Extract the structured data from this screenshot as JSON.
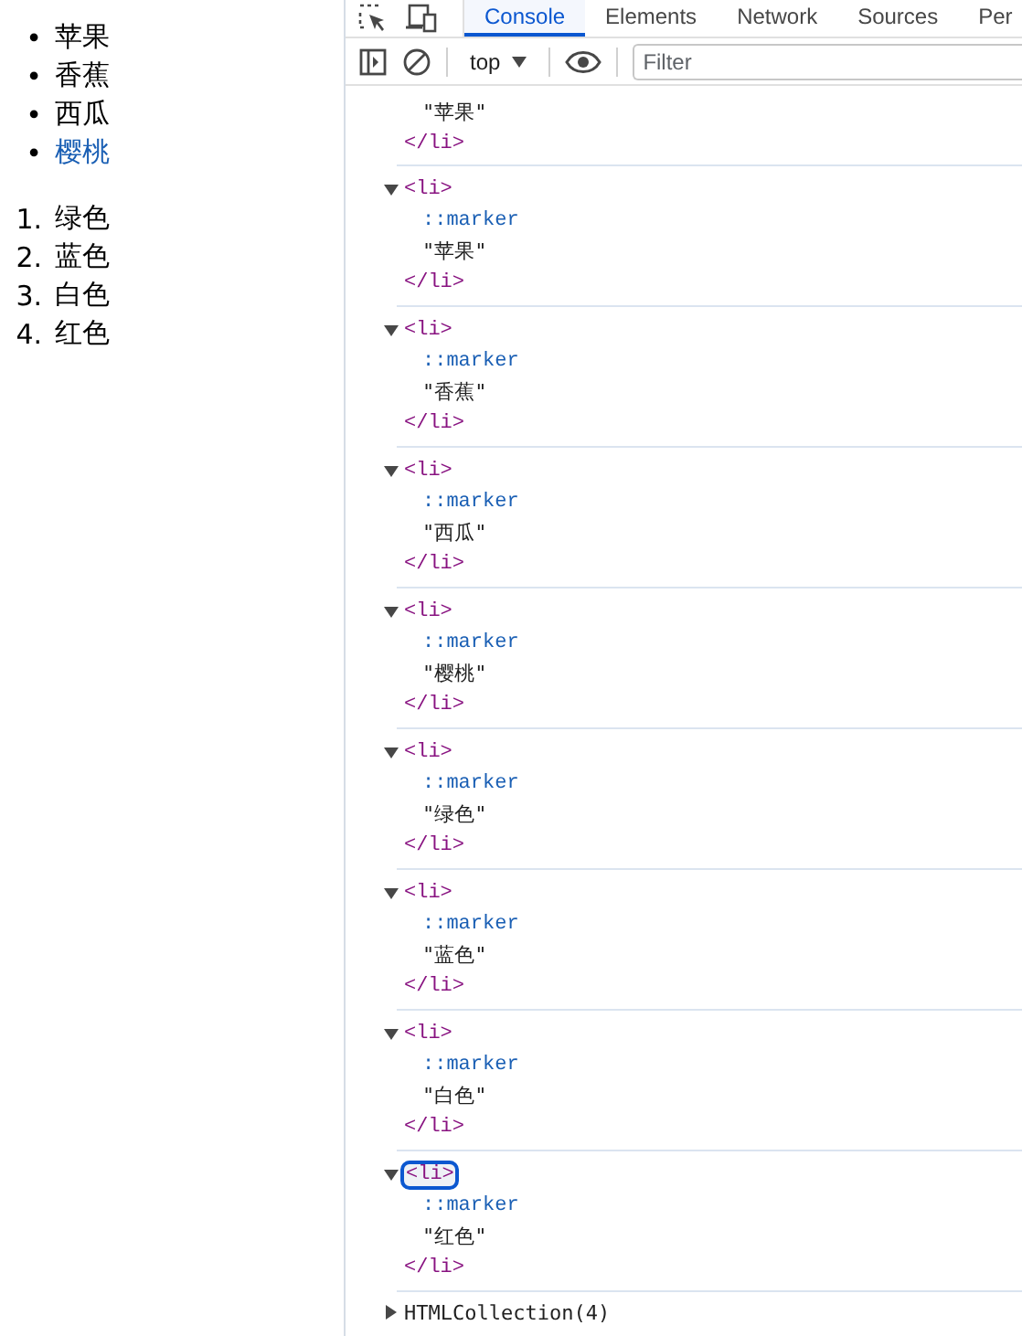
{
  "page": {
    "unordered_list": [
      {
        "bullet": "•",
        "text": "苹果",
        "highlighted": false
      },
      {
        "bullet": "•",
        "text": "香蕉",
        "highlighted": false
      },
      {
        "bullet": "•",
        "text": "西瓜",
        "highlighted": false
      },
      {
        "bullet": "•",
        "text": "樱桃",
        "highlighted": true
      }
    ],
    "ordered_list": [
      {
        "number": "1.",
        "text": "绿色"
      },
      {
        "number": "2.",
        "text": "蓝色"
      },
      {
        "number": "3.",
        "text": "白色"
      },
      {
        "number": "4.",
        "text": "红色"
      }
    ]
  },
  "devtools": {
    "tabs": [
      {
        "label": "Console",
        "selected": true
      },
      {
        "label": "Elements",
        "selected": false
      },
      {
        "label": "Network",
        "selected": false
      },
      {
        "label": "Sources",
        "selected": false
      },
      {
        "label": "Per",
        "selected": false
      }
    ],
    "context": "top",
    "filter": {
      "placeholder": "Filter"
    },
    "partial_entry": {
      "text": "\"苹果\"",
      "close_tag": "</li>"
    },
    "entries": [
      {
        "expanded": true,
        "focused": false,
        "open_tag": "<li>",
        "pseudo": "::marker",
        "text": "\"苹果\"",
        "close_tag": "</li>"
      },
      {
        "expanded": true,
        "focused": false,
        "open_tag": "<li>",
        "pseudo": "::marker",
        "text": "\"香蕉\"",
        "close_tag": "</li>"
      },
      {
        "expanded": true,
        "focused": false,
        "open_tag": "<li>",
        "pseudo": "::marker",
        "text": "\"西瓜\"",
        "close_tag": "</li>"
      },
      {
        "expanded": true,
        "focused": false,
        "open_tag": "<li>",
        "pseudo": "::marker",
        "text": "\"樱桃\"",
        "close_tag": "</li>"
      },
      {
        "expanded": true,
        "focused": false,
        "open_tag": "<li>",
        "pseudo": "::marker",
        "text": "\"绿色\"",
        "close_tag": "</li>"
      },
      {
        "expanded": true,
        "focused": false,
        "open_tag": "<li>",
        "pseudo": "::marker",
        "text": "\"蓝色\"",
        "close_tag": "</li>"
      },
      {
        "expanded": true,
        "focused": false,
        "open_tag": "<li>",
        "pseudo": "::marker",
        "text": "\"白色\"",
        "close_tag": "</li>"
      },
      {
        "expanded": true,
        "focused": true,
        "open_tag": "<li>",
        "pseudo": "::marker",
        "text": "\"红色\"",
        "close_tag": "</li>"
      }
    ],
    "summary": {
      "expanded": false,
      "text": "HTMLCollection(4)"
    }
  }
}
